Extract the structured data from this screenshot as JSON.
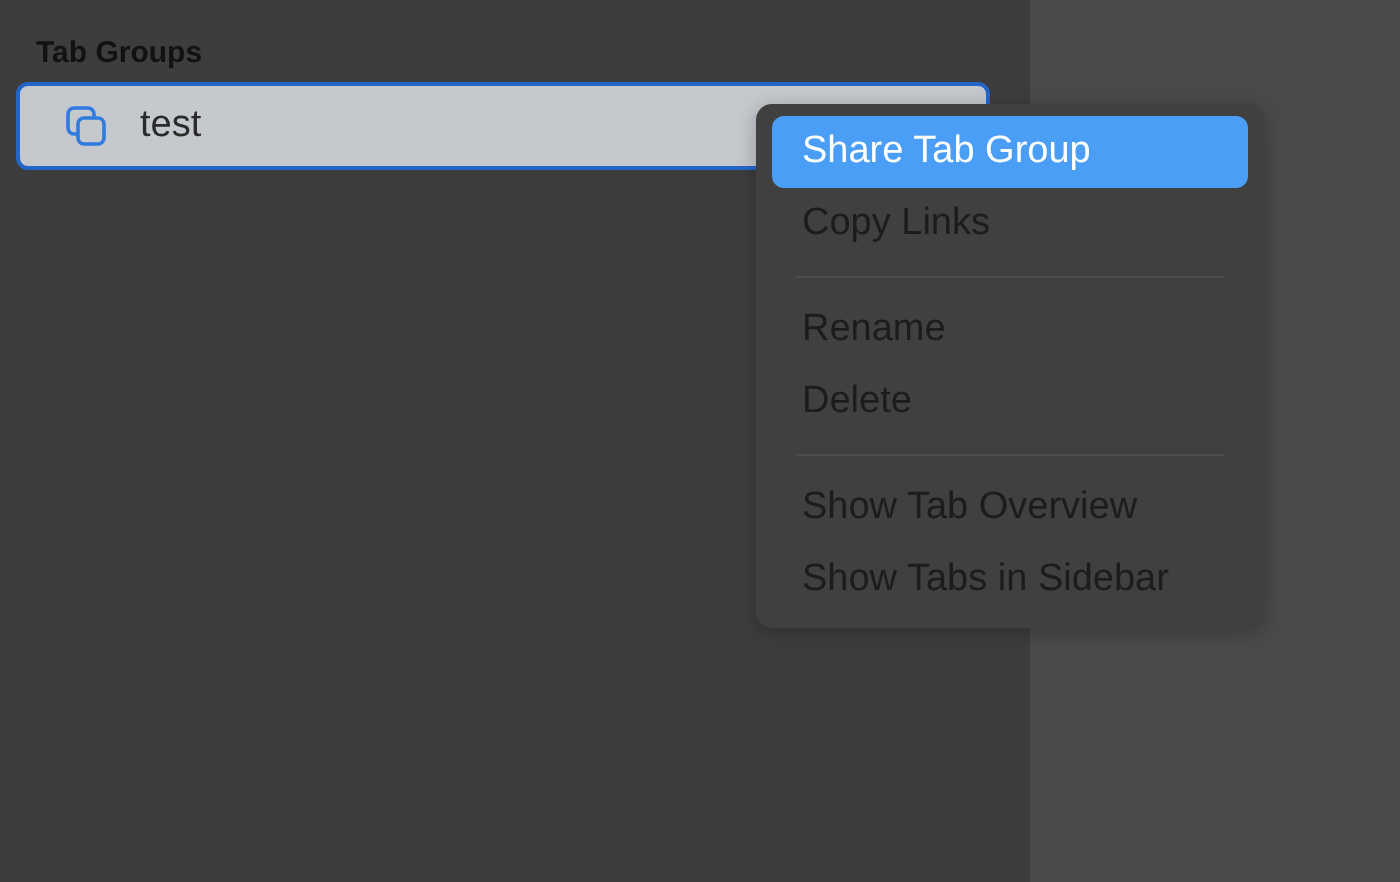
{
  "sidebar": {
    "section_title": "Tab Groups",
    "items": [
      {
        "label": "test",
        "selected": true
      }
    ]
  },
  "context_menu": {
    "items": [
      {
        "kind": "item",
        "label": "Share Tab Group",
        "selected": true
      },
      {
        "kind": "item",
        "label": "Copy Links",
        "selected": false
      },
      {
        "kind": "separator"
      },
      {
        "kind": "item",
        "label": "Rename",
        "selected": false
      },
      {
        "kind": "item",
        "label": "Delete",
        "selected": false
      },
      {
        "kind": "separator"
      },
      {
        "kind": "item",
        "label": "Show Tab Overview",
        "selected": false
      },
      {
        "kind": "item",
        "label": "Show Tabs in Sidebar",
        "selected": false
      }
    ]
  }
}
